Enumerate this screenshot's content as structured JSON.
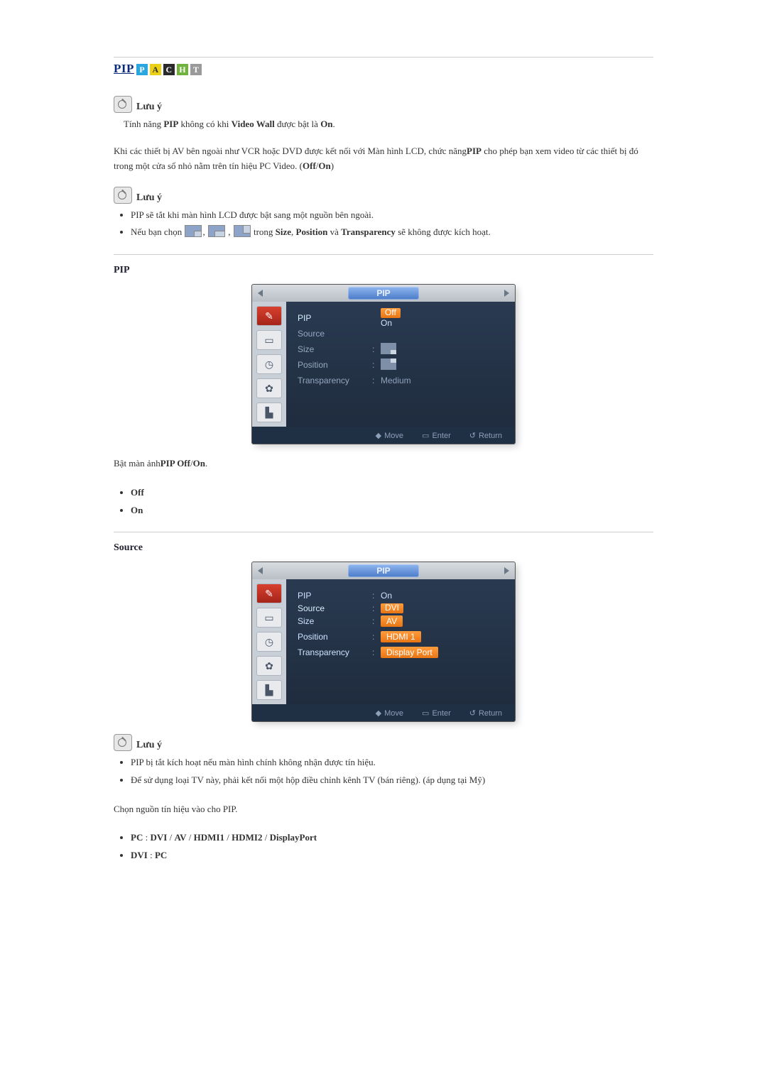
{
  "title": {
    "pip": "PIP",
    "letters": [
      "P",
      "A",
      "C",
      "H",
      "T"
    ]
  },
  "note_label": "Lưu ý",
  "note1": {
    "text_parts": [
      "Tính năng ",
      "PIP",
      " không có khi ",
      "Video Wall",
      " được bật là ",
      "On",
      "."
    ]
  },
  "intro": {
    "parts": [
      "Khi các thiết bị AV bên ngoài như VCR hoặc DVD được kết nối với Màn hình LCD, chức năng",
      "PIP",
      " cho phép bạn xem video từ các thiết bị đó trong một cửa sổ nhỏ nằm trên tín hiệu PC Video. (",
      "Off",
      "/",
      "On",
      ")"
    ]
  },
  "note2": {
    "b1": "PIP sẽ tắt khi màn hình LCD được bật sang một nguồn bên ngoài.",
    "b2_pre": "Nếu bạn chọn ",
    "b2_mid": " trong ",
    "b2_post_parts": [
      "Size",
      ", ",
      "Position",
      " và ",
      "Transparency",
      " sẽ không được kích hoạt."
    ]
  },
  "pip_section": {
    "heading": "PIP",
    "osd": {
      "tab": "PIP",
      "rows": {
        "pip": "PIP",
        "source": "Source",
        "size": "Size",
        "position": "Position",
        "transparency": "Transparency"
      },
      "values": {
        "off": "Off",
        "on": "On",
        "medium": "Medium"
      },
      "footer": {
        "move": "Move",
        "enter": "Enter",
        "return": "Return"
      }
    },
    "caption_parts": [
      "Bật màn ảnh",
      "PIP Off",
      "/",
      "On",
      "."
    ],
    "bullets": [
      "Off",
      "On"
    ]
  },
  "source_section": {
    "heading": "Source",
    "osd": {
      "tab": "PIP",
      "rows": {
        "pip": "PIP",
        "source": "Source",
        "size": "Size",
        "position": "Position",
        "transparency": "Transparency"
      },
      "values": {
        "pip": "On",
        "src_top": "DVI",
        "src2": "AV",
        "src3": "HDMI 1",
        "src4": "Display Port"
      },
      "footer": {
        "move": "Move",
        "enter": "Enter",
        "return": "Return"
      }
    },
    "note": {
      "b1": "PIP bị tắt kích hoạt nếu màn hình chính không nhận được tín hiệu.",
      "b2": "Để sử dụng loại TV này, phải kết nối một hộp điều chỉnh kênh TV (bán riêng). (áp dụng tại Mỹ)"
    },
    "caption": "Chọn nguồn tín hiệu vào cho PIP.",
    "bullets_parts": [
      [
        "PC",
        " : ",
        "DVI",
        " / ",
        "AV",
        " / ",
        "HDMI1",
        " / ",
        "HDMI2",
        " / ",
        "DisplayPort"
      ],
      [
        "DVI",
        " : ",
        "PC"
      ]
    ]
  }
}
